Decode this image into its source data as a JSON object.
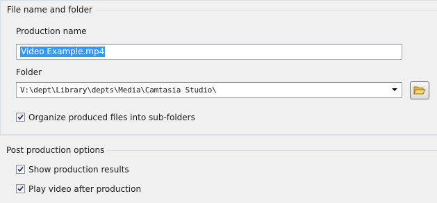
{
  "file_group": {
    "title": "File name and folder",
    "production_name_label": "Production name",
    "production_name_value": "Video Example.mp4",
    "folder_label": "Folder",
    "folder_value": "V:\\dept\\Library\\depts\\Media\\Camtasia Studio\\",
    "organize_label": "Organize produced files into sub-folders",
    "organize_checked": true,
    "browse_icon": "open-folder-icon"
  },
  "post_group": {
    "title": "Post production options",
    "show_results_label": "Show production results",
    "show_results_checked": true,
    "play_video_label": "Play video after production",
    "play_video_checked": true
  },
  "colors": {
    "selection": "#3399ff",
    "panel_bg": "#f0f0f0",
    "group_line": "#d5dfe5"
  }
}
